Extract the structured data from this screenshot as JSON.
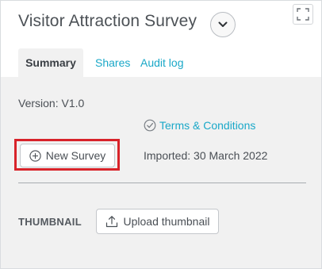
{
  "header": {
    "title": "Visitor Attraction Survey",
    "dropdown_icon": "chevron-down-icon",
    "expand_icon": "expand-icon"
  },
  "tabs": [
    {
      "label": "Summary",
      "active": true
    },
    {
      "label": "Shares",
      "active": false
    },
    {
      "label": "Audit log",
      "active": false
    }
  ],
  "summary": {
    "version": "Version: V1.0",
    "terms_link": "Terms & Conditions",
    "terms_icon": "check-circle-icon",
    "new_survey_label": "New Survey",
    "new_survey_icon": "plus-circle-icon",
    "imported": "Imported: 30 March 2022",
    "thumbnail_label": "THUMBNAIL",
    "upload_label": "Upload thumbnail",
    "upload_icon": "upload-icon"
  },
  "colors": {
    "link": "#1aa8c8",
    "highlight": "#d8232a",
    "content_bg": "#f1f1f1",
    "text": "#4a4f55"
  }
}
